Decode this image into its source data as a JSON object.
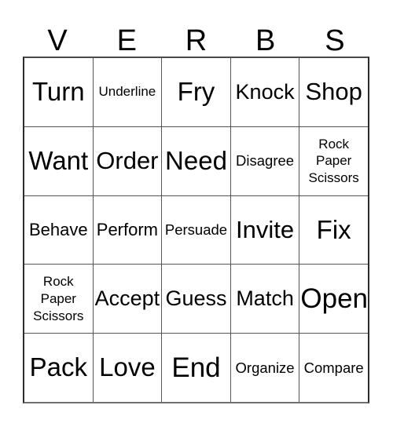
{
  "card": {
    "title_letters": [
      "V",
      "E",
      "R",
      "B",
      "S"
    ],
    "theme_word": "VERBS",
    "grid_size": "5x5",
    "colors": {
      "background": "#ffffff",
      "text": "#000000",
      "grid_line": "#555555",
      "outer_border": "#2b2b2b"
    },
    "rows": [
      {
        "cells": [
          {
            "text": "Turn",
            "size": "xl",
            "free_space": false
          },
          {
            "text": "Underline",
            "size": "xxs",
            "free_space": false
          },
          {
            "text": "Fry",
            "size": "xl",
            "free_space": false
          },
          {
            "text": "Knock",
            "size": "m",
            "free_space": false
          },
          {
            "text": "Shop",
            "size": "l",
            "free_space": false
          }
        ]
      },
      {
        "cells": [
          {
            "text": "Want",
            "size": "xl",
            "free_space": false
          },
          {
            "text": "Order",
            "size": "l",
            "free_space": false
          },
          {
            "text": "Need",
            "size": "xl",
            "free_space": false
          },
          {
            "text": "Disagree",
            "size": "xs",
            "free_space": false
          },
          {
            "text": "Rock\nPaper\nScissors",
            "size": "wrap",
            "free_space": true
          }
        ]
      },
      {
        "cells": [
          {
            "text": "Behave",
            "size": "s",
            "free_space": false
          },
          {
            "text": "Perform",
            "size": "s",
            "free_space": false
          },
          {
            "text": "Persuade",
            "size": "xs",
            "free_space": false
          },
          {
            "text": "Invite",
            "size": "l",
            "free_space": false
          },
          {
            "text": "Fix",
            "size": "xl",
            "free_space": false
          }
        ]
      },
      {
        "cells": [
          {
            "text": "Rock\nPaper\nScissors",
            "size": "wrap",
            "free_space": true
          },
          {
            "text": "Accept",
            "size": "m",
            "free_space": false
          },
          {
            "text": "Guess",
            "size": "m",
            "free_space": false
          },
          {
            "text": "Match",
            "size": "m",
            "free_space": false
          },
          {
            "text": "Open",
            "size": "xxl",
            "free_space": false
          }
        ]
      },
      {
        "cells": [
          {
            "text": "Pack",
            "size": "xl",
            "free_space": false
          },
          {
            "text": "Love",
            "size": "xl",
            "free_space": false
          },
          {
            "text": "End",
            "size": "xxl",
            "free_space": false
          },
          {
            "text": "Organize",
            "size": "xs",
            "free_space": false
          },
          {
            "text": "Compare",
            "size": "xs",
            "free_space": false
          }
        ]
      }
    ]
  }
}
